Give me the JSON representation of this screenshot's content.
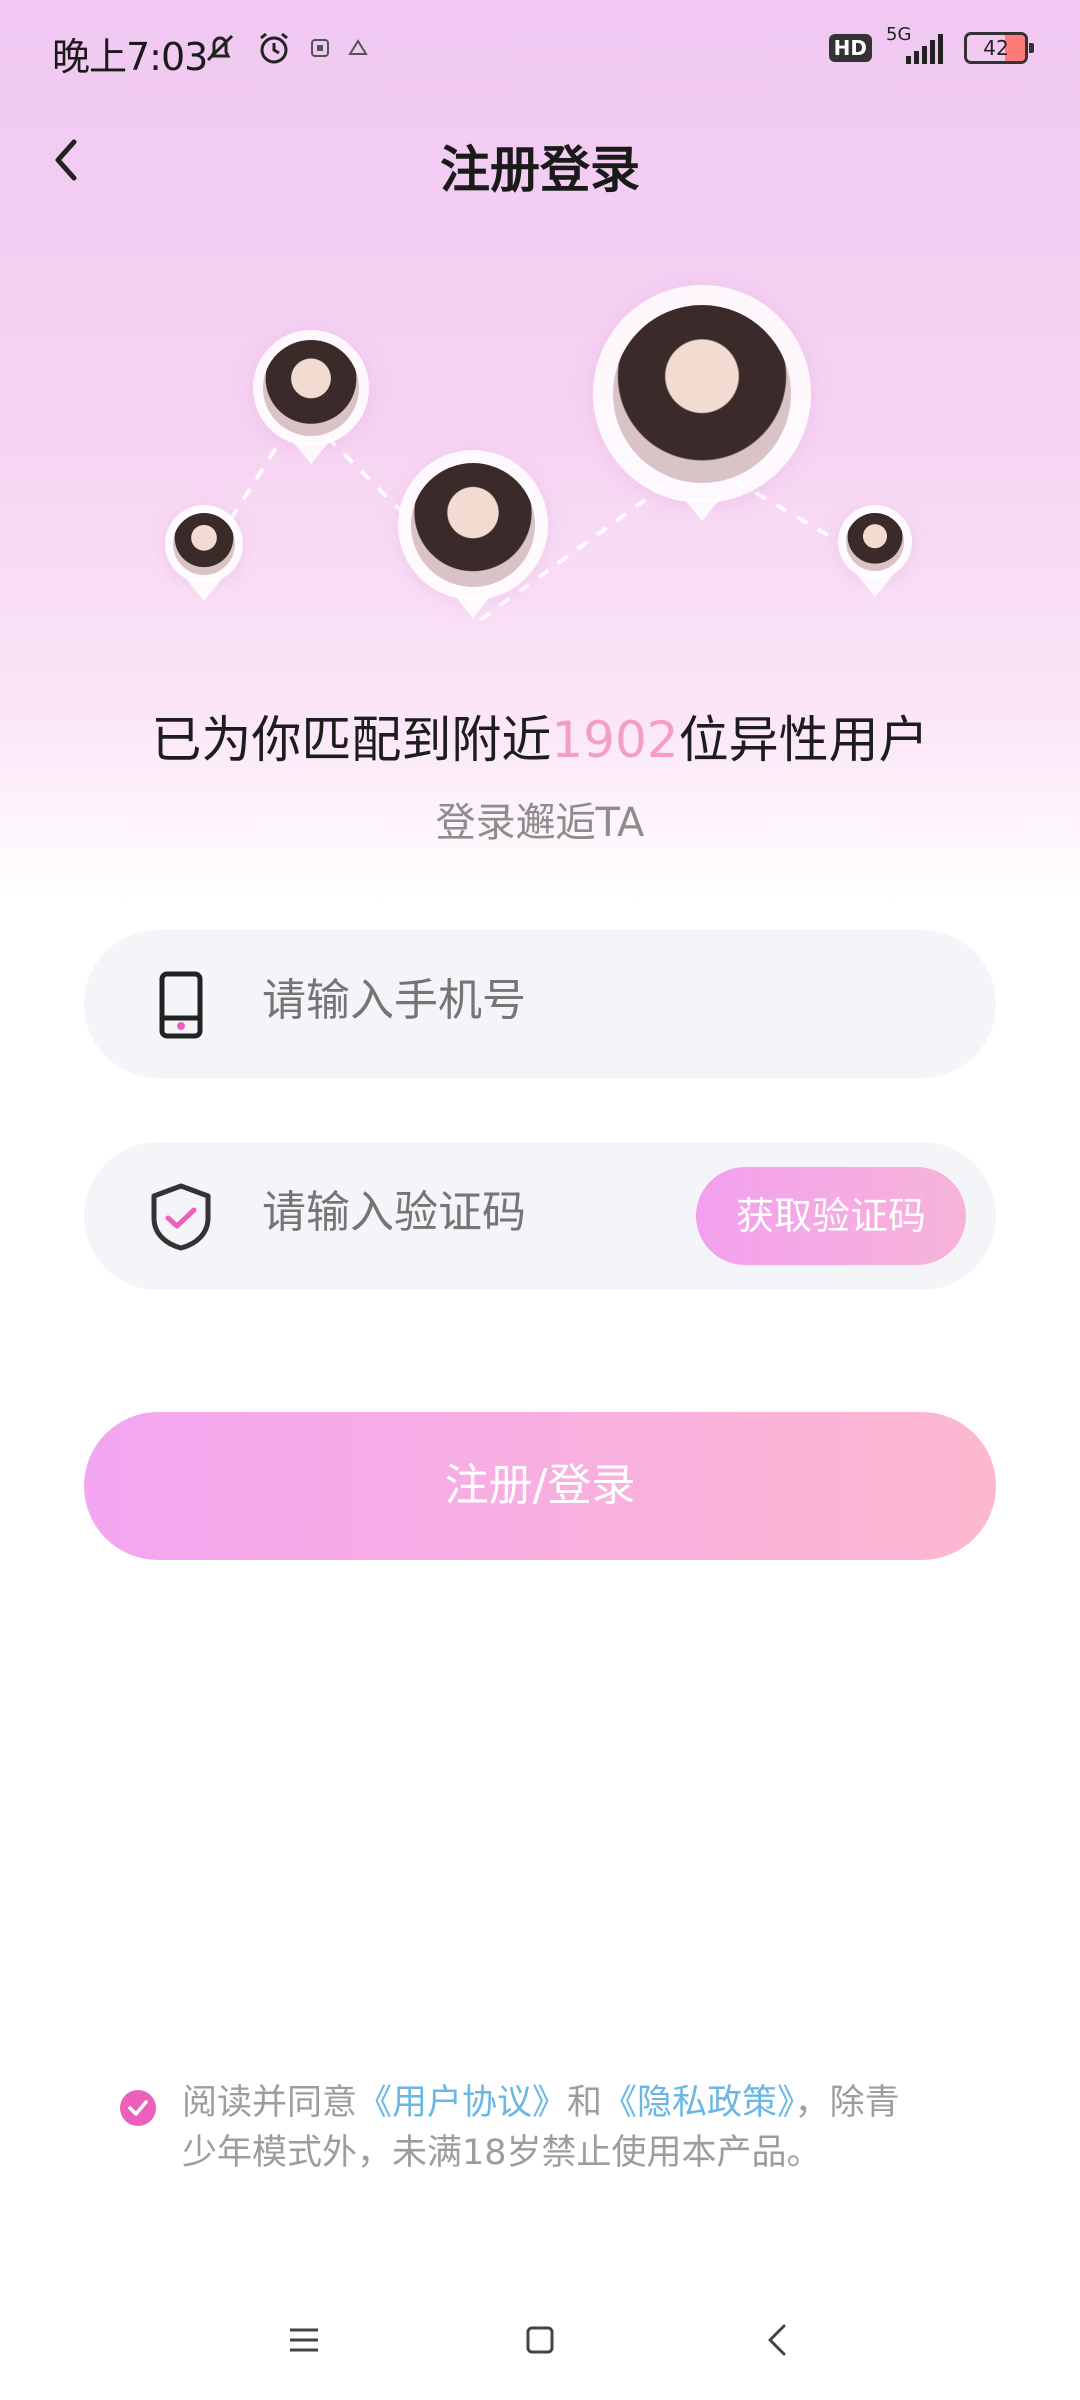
{
  "status_bar": {
    "time": "晚上7:03",
    "network": "5G",
    "hd": "HD",
    "battery": "42"
  },
  "header": {
    "title": "注册登录"
  },
  "match": {
    "prefix": "已为你匹配到附近",
    "count": "1902",
    "suffix": "位异性用户",
    "subtitle": "登录邂逅TA"
  },
  "form": {
    "phone_placeholder": "请输入手机号",
    "code_placeholder": "请输入验证码",
    "get_code_label": "获取验证码",
    "submit_label": "注册/登录"
  },
  "agreement": {
    "checked": true,
    "text_before": "阅读并同意",
    "user_agreement": "《用户协议》",
    "and": "和",
    "privacy_policy": "《隐私政策》",
    "text_after": "，除青少年模式外，未满18岁禁止使用本产品。"
  },
  "colors": {
    "accent_pink": "#f59ec4",
    "link_blue": "#6ab7e6",
    "check_pink": "#ec5fbb"
  }
}
